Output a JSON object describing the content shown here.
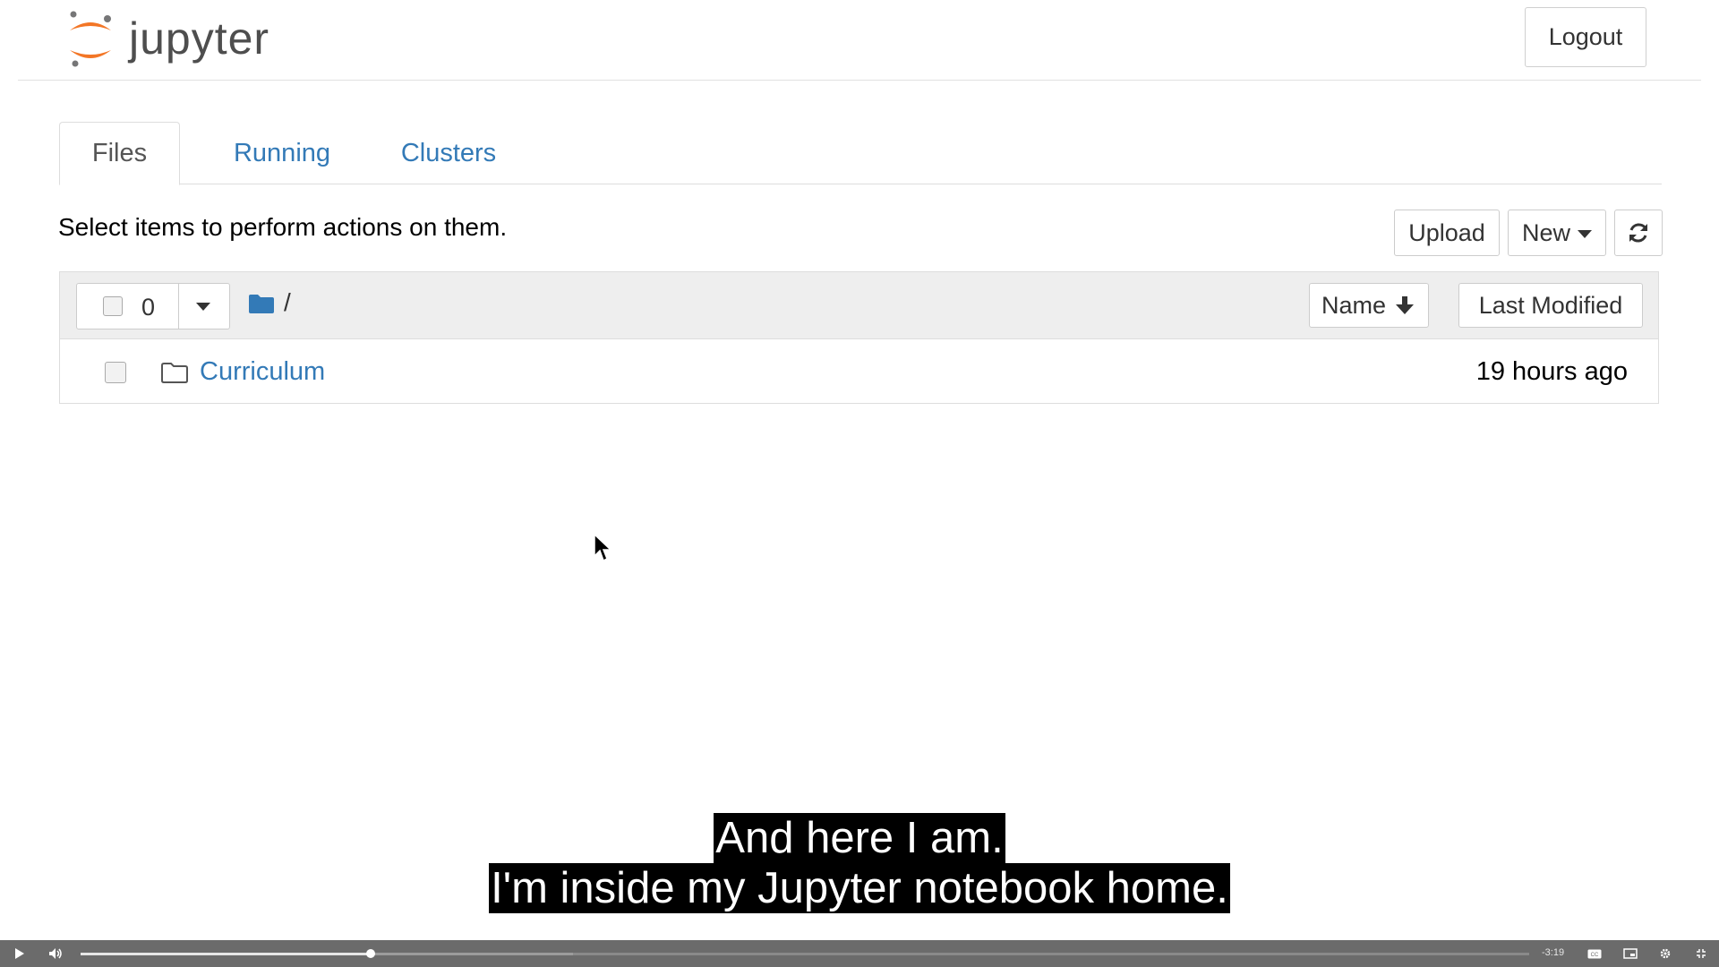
{
  "header": {
    "logo_text": "jupyter",
    "logout_label": "Logout"
  },
  "tabs": [
    {
      "label": "Files",
      "active": true
    },
    {
      "label": "Running",
      "active": false
    },
    {
      "label": "Clusters",
      "active": false
    }
  ],
  "toolbar": {
    "hint": "Select items to perform actions on them.",
    "upload_label": "Upload",
    "new_label": "New",
    "refresh_icon": "refresh-icon"
  },
  "file_list": {
    "selected_count": "0",
    "breadcrumb": "/",
    "sort_name_label": "Name",
    "sort_modified_label": "Last Modified",
    "items": [
      {
        "type": "folder",
        "name": "Curriculum",
        "modified": "19 hours ago"
      }
    ]
  },
  "captions": {
    "line1": "And here I am.",
    "line2": "I'm inside my Jupyter notebook home."
  },
  "player": {
    "time_remaining": "-3:19",
    "progress_fraction": 0.2,
    "buffered_fraction": 0.34
  },
  "colors": {
    "link": "#337ab7",
    "jupyter_orange": "#f37626",
    "folder_blue": "#337ab7"
  }
}
